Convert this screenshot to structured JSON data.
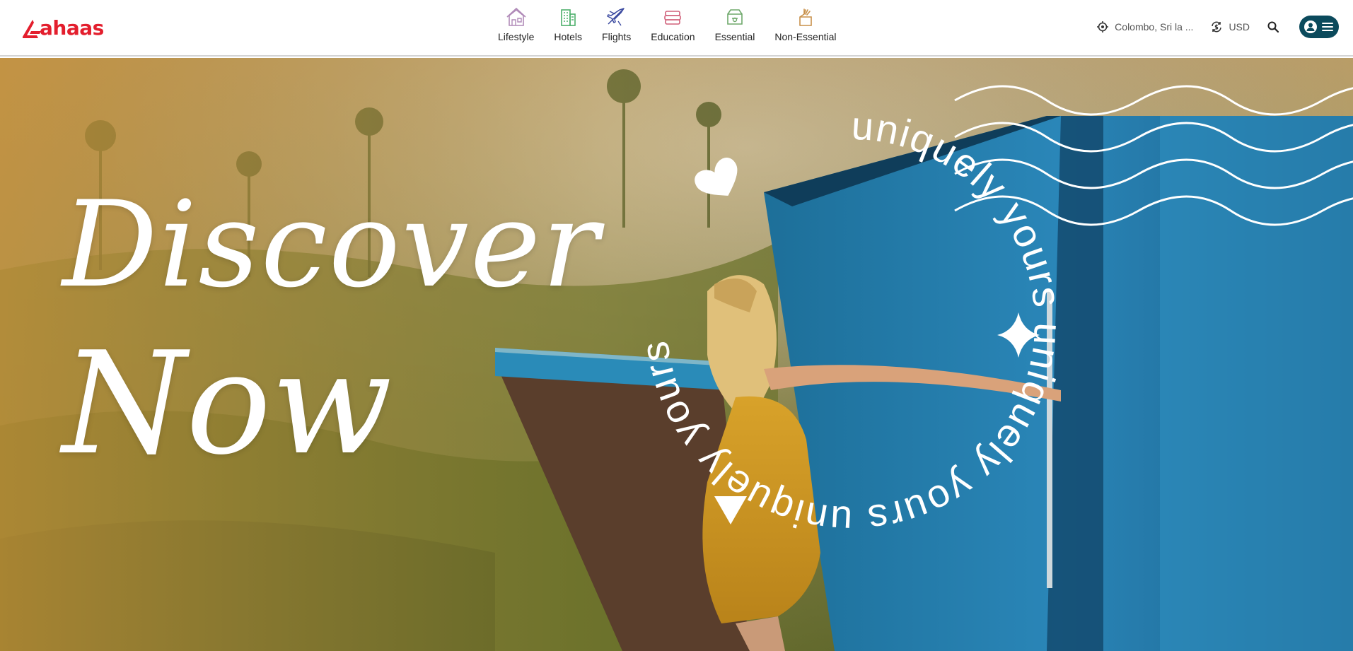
{
  "brand": {
    "name": "Aahaas",
    "logo_text": "ahaas",
    "color": "#e31e2d"
  },
  "nav": {
    "items": [
      {
        "label": "Lifestyle",
        "icon": "lifestyle-icon",
        "color": "#b08ab8"
      },
      {
        "label": "Hotels",
        "icon": "hotel-icon",
        "color": "#4caf6a"
      },
      {
        "label": "Flights",
        "icon": "flight-icon",
        "color": "#3b4aa0"
      },
      {
        "label": "Education",
        "icon": "education-icon",
        "color": "#d0607a"
      },
      {
        "label": "Essential",
        "icon": "essential-icon",
        "color": "#6ea86a"
      },
      {
        "label": "Non-Essential",
        "icon": "non-essential-icon",
        "color": "#c8904a"
      }
    ]
  },
  "tools": {
    "location": "Colombo, Sri la ...",
    "currency": "USD",
    "menu_color": "#0b4a5c"
  },
  "hero": {
    "title_line1": "Discover",
    "title_line2": "Now",
    "badge_text": "uniquely yours",
    "badge_symbols": [
      "heart",
      "sparkle",
      "triangle"
    ]
  }
}
